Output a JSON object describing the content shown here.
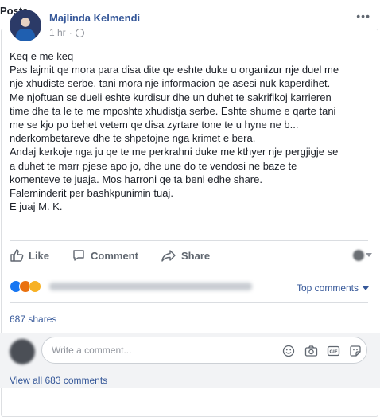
{
  "section": {
    "title": "Posts"
  },
  "post": {
    "author": "Majlinda Kelmendi",
    "time": "1 hr",
    "privacy_icon": "globe-icon",
    "more_label": "•••",
    "lines": [
      "Keq e me keq",
      "Pas lajmit qe mora para disa dite qe eshte duke u organizur nje duel me",
      "nje xhudiste serbe, tani mora nje informacion qe asesi nuk kaperdihet.",
      "Me njoftuan se dueli eshte kurdisur dhe un duhet te sakrifikoj karrieren",
      "time dhe ta le te me mposhte xhudistja serbe. Eshte shume e qarte tani",
      "me se kjo po behet vetem qe disa zyrtare tone te u hyne ne b...",
      "nderkombetareve dhe te shpetojne nga krimet e bera.",
      "Andaj kerkoje nga ju qe te me perkrahni duke me kthyer nje pergjigje se",
      "a duhet te marr pjese apo jo, dhe une do te vendosi ne baze te",
      "komenteve te juaja. Mos harroni qe ta beni edhe share.",
      "Faleminderit per bashkpunimin tuaj.",
      "E juaj M. K."
    ]
  },
  "actions": {
    "like": "Like",
    "comment": "Comment",
    "share": "Share"
  },
  "stats": {
    "reaction_icons": [
      "like-reaction-icon",
      "angry-reaction-icon",
      "wow-reaction-icon"
    ],
    "sort_label": "Top comments",
    "shares": "687 shares"
  },
  "composer": {
    "placeholder": "Write a comment..."
  },
  "footer": {
    "view_all": "View all 683 comments"
  },
  "colors": {
    "link": "#365899",
    "muted": "#90949c",
    "action": "#606770",
    "like_blue": "#1877f2"
  }
}
